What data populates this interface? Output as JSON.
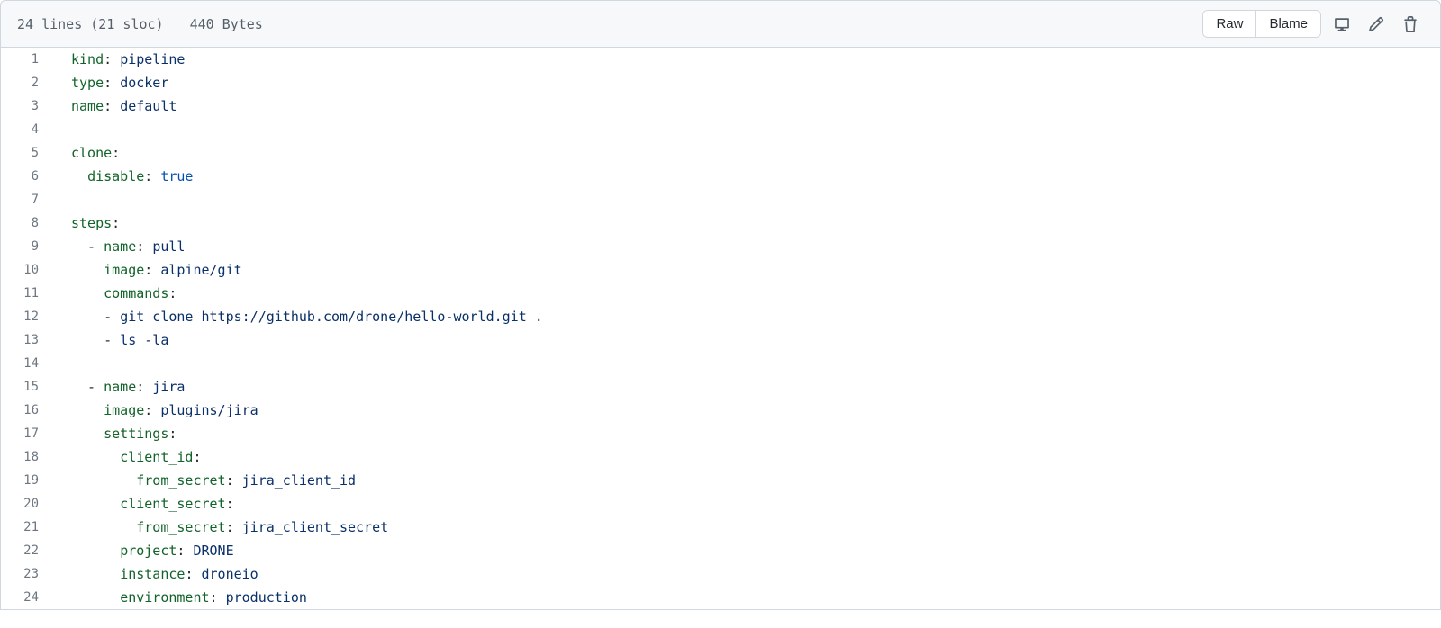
{
  "header": {
    "lines_info": "24 lines (21 sloc)",
    "size_info": "440 Bytes",
    "raw_label": "Raw",
    "blame_label": "Blame"
  },
  "code": {
    "lines": [
      {
        "n": 1,
        "tokens": [
          {
            "t": "kind",
            "c": "pl-ent"
          },
          {
            "t": ": ",
            "c": ""
          },
          {
            "t": "pipeline",
            "c": "pl-s"
          }
        ]
      },
      {
        "n": 2,
        "tokens": [
          {
            "t": "type",
            "c": "pl-ent"
          },
          {
            "t": ": ",
            "c": ""
          },
          {
            "t": "docker",
            "c": "pl-s"
          }
        ]
      },
      {
        "n": 3,
        "tokens": [
          {
            "t": "name",
            "c": "pl-ent"
          },
          {
            "t": ": ",
            "c": ""
          },
          {
            "t": "default",
            "c": "pl-s"
          }
        ]
      },
      {
        "n": 4,
        "tokens": []
      },
      {
        "n": 5,
        "tokens": [
          {
            "t": "clone",
            "c": "pl-ent"
          },
          {
            "t": ":",
            "c": ""
          }
        ]
      },
      {
        "n": 6,
        "tokens": [
          {
            "t": "  ",
            "c": ""
          },
          {
            "t": "disable",
            "c": "pl-ent"
          },
          {
            "t": ": ",
            "c": ""
          },
          {
            "t": "true",
            "c": "pl-c1"
          }
        ]
      },
      {
        "n": 7,
        "tokens": []
      },
      {
        "n": 8,
        "tokens": [
          {
            "t": "steps",
            "c": "pl-ent"
          },
          {
            "t": ":",
            "c": ""
          }
        ]
      },
      {
        "n": 9,
        "tokens": [
          {
            "t": "  - ",
            "c": ""
          },
          {
            "t": "name",
            "c": "pl-ent"
          },
          {
            "t": ": ",
            "c": ""
          },
          {
            "t": "pull",
            "c": "pl-s"
          }
        ]
      },
      {
        "n": 10,
        "tokens": [
          {
            "t": "    ",
            "c": ""
          },
          {
            "t": "image",
            "c": "pl-ent"
          },
          {
            "t": ": ",
            "c": ""
          },
          {
            "t": "alpine/git",
            "c": "pl-s"
          }
        ]
      },
      {
        "n": 11,
        "tokens": [
          {
            "t": "    ",
            "c": ""
          },
          {
            "t": "commands",
            "c": "pl-ent"
          },
          {
            "t": ":",
            "c": ""
          }
        ]
      },
      {
        "n": 12,
        "tokens": [
          {
            "t": "    - ",
            "c": ""
          },
          {
            "t": "git clone https://github.com/drone/hello-world.git .",
            "c": "pl-s"
          }
        ]
      },
      {
        "n": 13,
        "tokens": [
          {
            "t": "    - ",
            "c": ""
          },
          {
            "t": "ls -la",
            "c": "pl-s"
          }
        ]
      },
      {
        "n": 14,
        "tokens": []
      },
      {
        "n": 15,
        "tokens": [
          {
            "t": "  - ",
            "c": ""
          },
          {
            "t": "name",
            "c": "pl-ent"
          },
          {
            "t": ": ",
            "c": ""
          },
          {
            "t": "jira",
            "c": "pl-s"
          }
        ]
      },
      {
        "n": 16,
        "tokens": [
          {
            "t": "    ",
            "c": ""
          },
          {
            "t": "image",
            "c": "pl-ent"
          },
          {
            "t": ": ",
            "c": ""
          },
          {
            "t": "plugins/jira",
            "c": "pl-s"
          }
        ]
      },
      {
        "n": 17,
        "tokens": [
          {
            "t": "    ",
            "c": ""
          },
          {
            "t": "settings",
            "c": "pl-ent"
          },
          {
            "t": ":",
            "c": ""
          }
        ]
      },
      {
        "n": 18,
        "tokens": [
          {
            "t": "      ",
            "c": ""
          },
          {
            "t": "client_id",
            "c": "pl-ent"
          },
          {
            "t": ":",
            "c": ""
          }
        ]
      },
      {
        "n": 19,
        "tokens": [
          {
            "t": "        ",
            "c": ""
          },
          {
            "t": "from_secret",
            "c": "pl-ent"
          },
          {
            "t": ": ",
            "c": ""
          },
          {
            "t": "jira_client_id",
            "c": "pl-s"
          }
        ]
      },
      {
        "n": 20,
        "tokens": [
          {
            "t": "      ",
            "c": ""
          },
          {
            "t": "client_secret",
            "c": "pl-ent"
          },
          {
            "t": ":",
            "c": ""
          }
        ]
      },
      {
        "n": 21,
        "tokens": [
          {
            "t": "        ",
            "c": ""
          },
          {
            "t": "from_secret",
            "c": "pl-ent"
          },
          {
            "t": ": ",
            "c": ""
          },
          {
            "t": "jira_client_secret",
            "c": "pl-s"
          }
        ]
      },
      {
        "n": 22,
        "tokens": [
          {
            "t": "      ",
            "c": ""
          },
          {
            "t": "project",
            "c": "pl-ent"
          },
          {
            "t": ": ",
            "c": ""
          },
          {
            "t": "DRONE",
            "c": "pl-s"
          }
        ]
      },
      {
        "n": 23,
        "tokens": [
          {
            "t": "      ",
            "c": ""
          },
          {
            "t": "instance",
            "c": "pl-ent"
          },
          {
            "t": ": ",
            "c": ""
          },
          {
            "t": "droneio",
            "c": "pl-s"
          }
        ]
      },
      {
        "n": 24,
        "tokens": [
          {
            "t": "      ",
            "c": ""
          },
          {
            "t": "environment",
            "c": "pl-ent"
          },
          {
            "t": ": ",
            "c": ""
          },
          {
            "t": "production",
            "c": "pl-s"
          }
        ]
      }
    ]
  }
}
